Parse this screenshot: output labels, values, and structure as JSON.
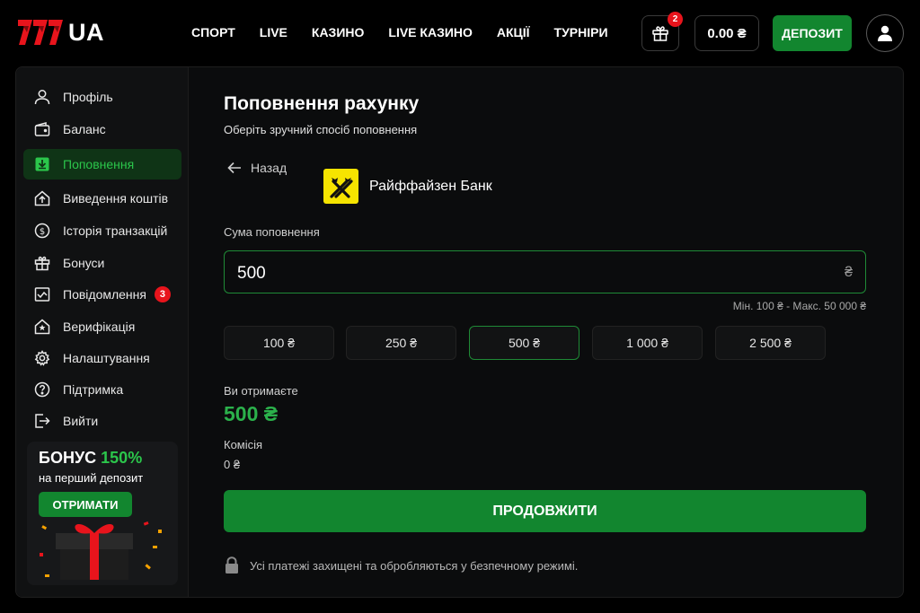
{
  "header": {
    "logo_text": "UA",
    "logo_mark": "777",
    "nav": [
      "СПОРТ",
      "LIVE",
      "КАЗИНО",
      "LIVE КАЗИНО",
      "АКЦІЇ",
      "ТУРНІРИ"
    ],
    "gift_count": "2",
    "balance": "0.00 ₴",
    "deposit_label": "ДЕПОЗИТ"
  },
  "sidebar": {
    "items": [
      {
        "label": "Профіль",
        "icon": "user-icon"
      },
      {
        "label": "Баланс",
        "icon": "wallet-icon"
      },
      {
        "label": "Поповнення",
        "icon": "deposit-icon",
        "active": true
      },
      {
        "label": "Виведення коштів",
        "icon": "withdraw-icon"
      },
      {
        "label": "Історія транзакцій",
        "icon": "history-icon"
      },
      {
        "label": "Бонуси",
        "icon": "gift-icon"
      },
      {
        "label": "Повідомлення",
        "icon": "mail-icon",
        "badge": "3"
      },
      {
        "label": "Верифікація",
        "icon": "verification-icon"
      },
      {
        "label": "Налаштування",
        "icon": "settings-icon"
      },
      {
        "label": "Підтримка",
        "icon": "help-icon"
      },
      {
        "label": "Вийти",
        "icon": "logout-icon"
      }
    ],
    "promo": {
      "title": "БОНУС",
      "percent": "150%",
      "subtitle": "на перший депозит",
      "button": "ОТРИМАТИ"
    }
  },
  "main": {
    "title": "Поповнення рахунку",
    "subtitle": "Оберіть зручний спосіб поповнення",
    "back_label": "Назад",
    "bank_name": "Райффайзен Банк",
    "amount_label": "Сума поповнення",
    "amount_value": "500",
    "currency": "₴",
    "limits": "Мін. 100 ₴ - Макс. 50 000 ₴",
    "presets": [
      "100 ₴",
      "250 ₴",
      "500 ₴",
      "1 000 ₴",
      "2 500 ₴"
    ],
    "selected_preset": "500 ₴",
    "receive_label": "Ви отримаєте",
    "receive_value": "500 ₴",
    "fee_label": "Комісія",
    "fee_value": "0 ₴",
    "continue_label": "ПРОДОВЖИТИ",
    "secure_note": "Усі платежі захищені та обробляються у безпечному режимі."
  },
  "colors": {
    "accent_green": "#12862f",
    "text_green": "#2bc64b",
    "badge_red": "#e8141c",
    "bank_yellow": "#f6e400"
  }
}
